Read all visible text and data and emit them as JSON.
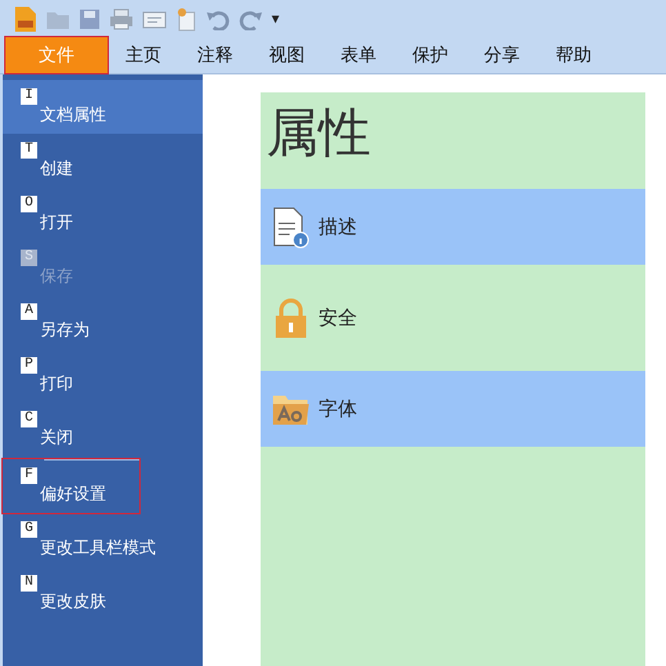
{
  "toolbar": {
    "overflow": "▾"
  },
  "tabs": [
    {
      "label": "文件",
      "selected": true,
      "outlined": true
    },
    {
      "label": "主页",
      "selected": false,
      "outlined": false
    },
    {
      "label": "注释",
      "selected": false,
      "outlined": false
    },
    {
      "label": "视图",
      "selected": false,
      "outlined": false
    },
    {
      "label": "表单",
      "selected": false,
      "outlined": false
    },
    {
      "label": "保护",
      "selected": false,
      "outlined": false
    },
    {
      "label": "分享",
      "selected": false,
      "outlined": false
    },
    {
      "label": "帮助",
      "selected": false,
      "outlined": false
    }
  ],
  "file_menu": [
    {
      "key": "I",
      "label": "文档属性",
      "selected": true,
      "disabled": false,
      "outlined": false,
      "divider_before": false
    },
    {
      "key": "T",
      "label": "创建",
      "selected": false,
      "disabled": false,
      "outlined": false,
      "divider_before": false
    },
    {
      "key": "O",
      "label": "打开",
      "selected": false,
      "disabled": false,
      "outlined": false,
      "divider_before": false
    },
    {
      "key": "S",
      "label": "保存",
      "selected": false,
      "disabled": true,
      "outlined": false,
      "divider_before": false
    },
    {
      "key": "A",
      "label": "另存为",
      "selected": false,
      "disabled": false,
      "outlined": false,
      "divider_before": false
    },
    {
      "key": "P",
      "label": "打印",
      "selected": false,
      "disabled": false,
      "outlined": false,
      "divider_before": false
    },
    {
      "key": "C",
      "label": "关闭",
      "selected": false,
      "disabled": false,
      "outlined": false,
      "divider_before": false
    },
    {
      "key": "F",
      "label": "偏好设置",
      "selected": false,
      "disabled": false,
      "outlined": true,
      "divider_before": true
    },
    {
      "key": "G",
      "label": "更改工具栏模式",
      "selected": false,
      "disabled": false,
      "outlined": false,
      "divider_before": false
    },
    {
      "key": "N",
      "label": "更改皮肤",
      "selected": false,
      "disabled": false,
      "outlined": false,
      "divider_before": false
    }
  ],
  "properties": {
    "title": "属性",
    "items": [
      {
        "kind": "description",
        "label": "描述"
      },
      {
        "kind": "security",
        "label": "安全"
      },
      {
        "kind": "fonts",
        "label": "字体"
      }
    ]
  }
}
